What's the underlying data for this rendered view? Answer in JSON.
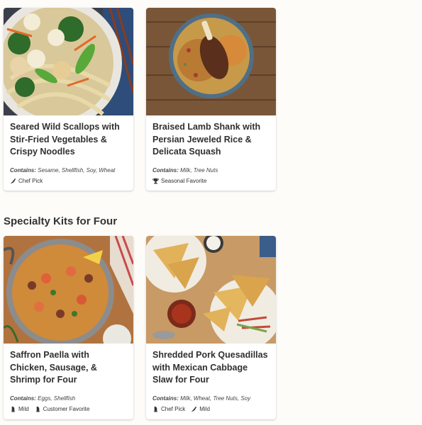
{
  "top_cards": [
    {
      "title": "Seared Wild Scallops with Stir-Fried Vegetables & Crispy Noodles",
      "contains_label": "Contains:",
      "contains": "Sesame, Shellfish, Soy, Wheat",
      "tags": [
        {
          "icon": "chef-knife-icon",
          "label": "Chef Pick"
        }
      ]
    },
    {
      "title": "Braised Lamb Shank with Persian Jeweled Rice & Delicata Squash",
      "contains_label": "Contains:",
      "contains": "Milk, Tree Nuts",
      "tags": [
        {
          "icon": "trophy-icon",
          "label": "Seasonal Favorite"
        }
      ]
    }
  ],
  "section": {
    "title": "Specialty Kits for Four"
  },
  "bottom_cards": [
    {
      "title": "Saffron Paella with Chicken, Sausage, & Shrimp for Four",
      "contains_label": "Contains:",
      "contains": "Eggs, Shellfish",
      "tags": [
        {
          "icon": "pepper-icon",
          "label": "Mild"
        },
        {
          "icon": "badge-icon",
          "label": "Customer Favorite"
        }
      ]
    },
    {
      "title": "Shredded Pork Quesadillas with Mexican Cabbage Slaw for Four",
      "contains_label": "Contains:",
      "contains": "Milk, Wheat, Tree Nuts, Soy",
      "tags": [
        {
          "icon": "chef-hat-icon",
          "label": "Chef Pick"
        },
        {
          "icon": "chili-icon",
          "label": "Mild"
        }
      ]
    }
  ]
}
